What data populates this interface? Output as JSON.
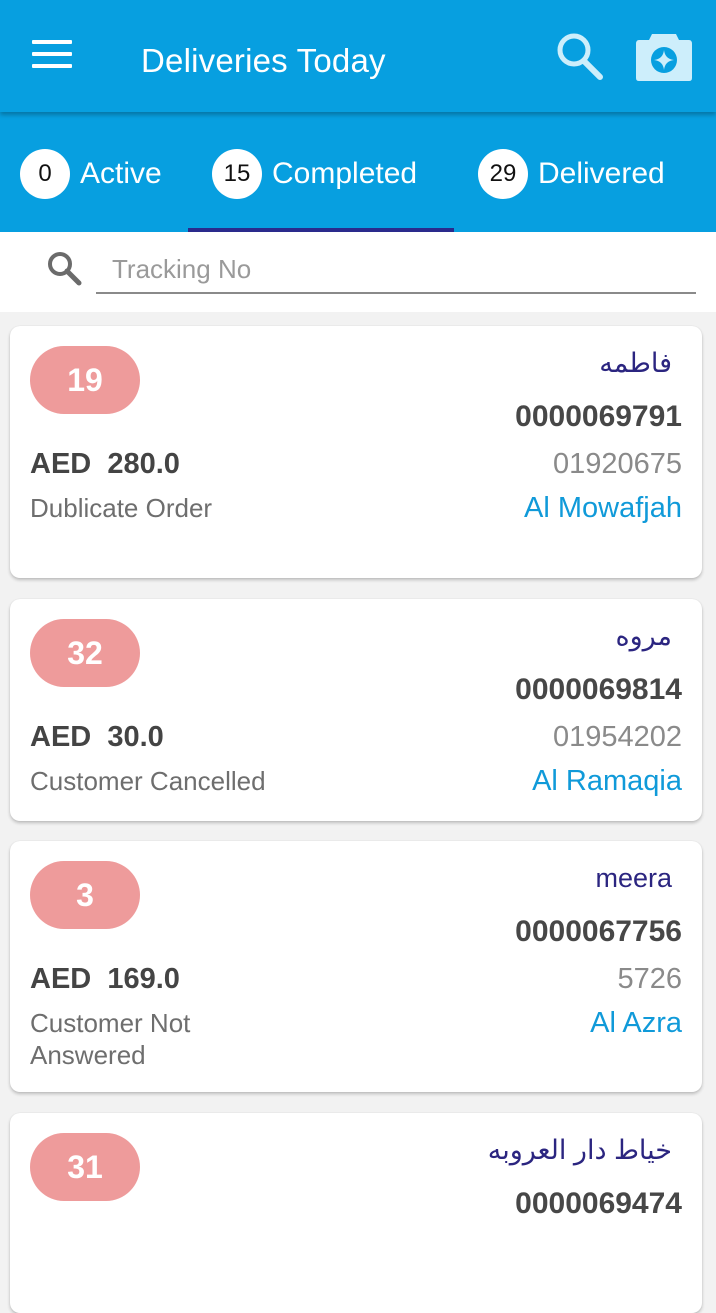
{
  "header": {
    "title": "Deliveries Today",
    "icons": {
      "menu": "hamburger-menu-icon",
      "search": "search-icon",
      "camera": "camera-scan-icon"
    }
  },
  "colors": {
    "primary": "#079fe0",
    "tab_indicator": "#2a2a8c",
    "badge": "#ee9b9b",
    "name_text": "#2b2580",
    "area_link": "#109ad9"
  },
  "tabs": [
    {
      "count": "0",
      "label": "Active",
      "selected": false
    },
    {
      "count": "15",
      "label": "Completed",
      "selected": true
    },
    {
      "count": "29",
      "label": "Delivered",
      "selected": false
    }
  ],
  "search": {
    "placeholder": "Tracking No",
    "value": ""
  },
  "deliveries": [
    {
      "seq": "19",
      "name": "فاطمه",
      "order_no": "0000069791",
      "amount": "AED  280.0",
      "phone": "01920675",
      "reason": "Dublicate Order",
      "area": "Al Mowafjah"
    },
    {
      "seq": "32",
      "name": "مروه",
      "order_no": "0000069814",
      "amount": "AED  30.0",
      "phone": "01954202",
      "reason": "Customer Cancelled",
      "area": "Al Ramaqia"
    },
    {
      "seq": "3",
      "name": "meera",
      "order_no": "0000067756",
      "amount": "AED  169.0",
      "phone": "5726",
      "reason": "Customer Not Answered",
      "area": "Al Azra"
    },
    {
      "seq": "31",
      "name": "خياط دار العروبه",
      "order_no": "0000069474"
    }
  ]
}
